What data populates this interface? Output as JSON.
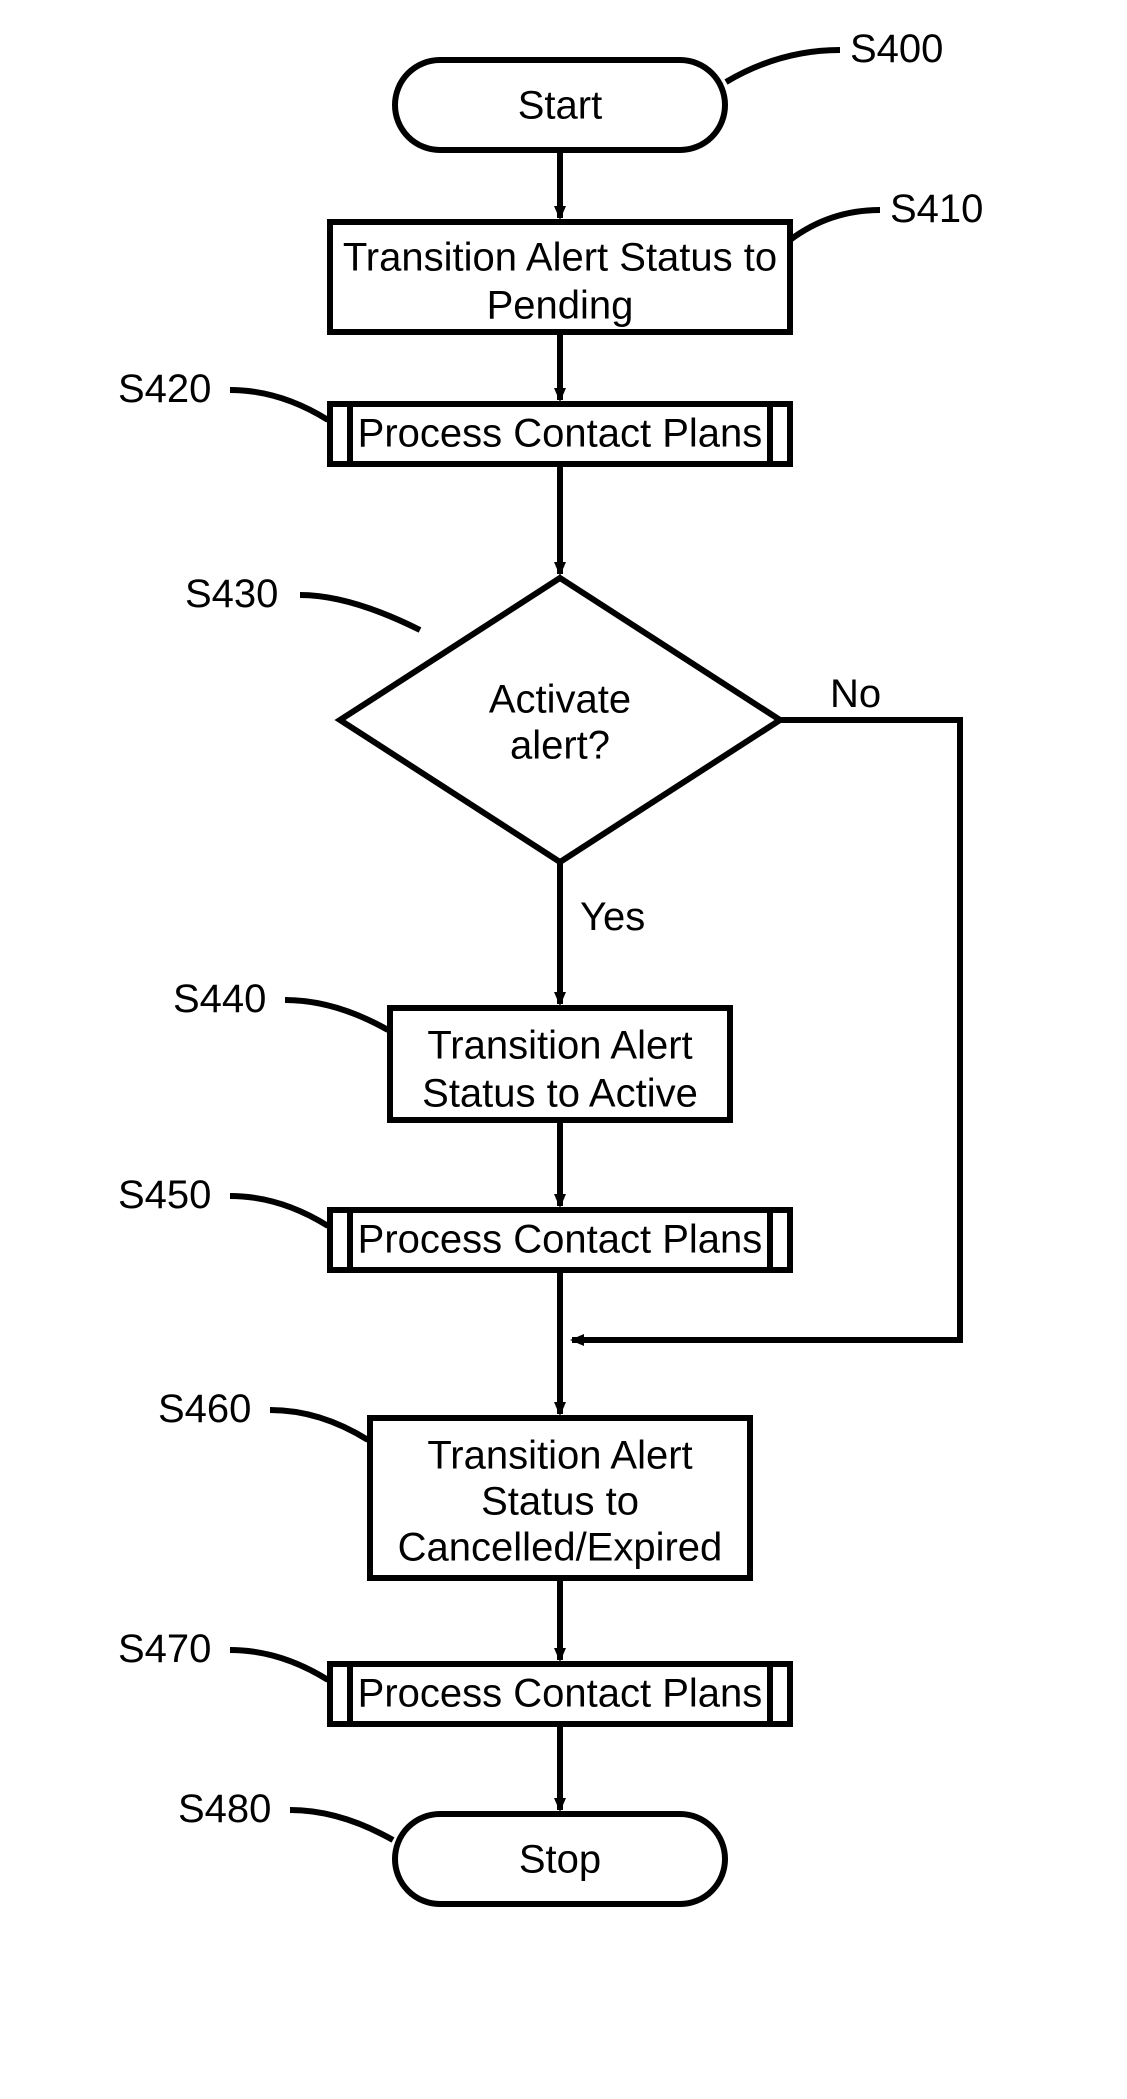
{
  "diagram": {
    "nodes": {
      "start": {
        "label": "Start",
        "ref": "S400"
      },
      "s410": {
        "line1": "Transition Alert Status to",
        "line2": "Pending",
        "ref": "S410"
      },
      "s420": {
        "label": "Process Contact Plans",
        "ref": "S420"
      },
      "s430": {
        "line1": "Activate",
        "line2": "alert?",
        "ref": "S430"
      },
      "s440": {
        "line1": "Transition Alert",
        "line2": "Status to Active",
        "ref": "S440"
      },
      "s450": {
        "label": "Process Contact Plans",
        "ref": "S450"
      },
      "s460": {
        "line1": "Transition Alert",
        "line2": "Status to",
        "line3": "Cancelled/Expired",
        "ref": "S460"
      },
      "s470": {
        "label": "Process Contact Plans",
        "ref": "S470"
      },
      "stop": {
        "label": "Stop",
        "ref": "S480"
      }
    },
    "edges": {
      "yes": "Yes",
      "no": "No"
    }
  }
}
